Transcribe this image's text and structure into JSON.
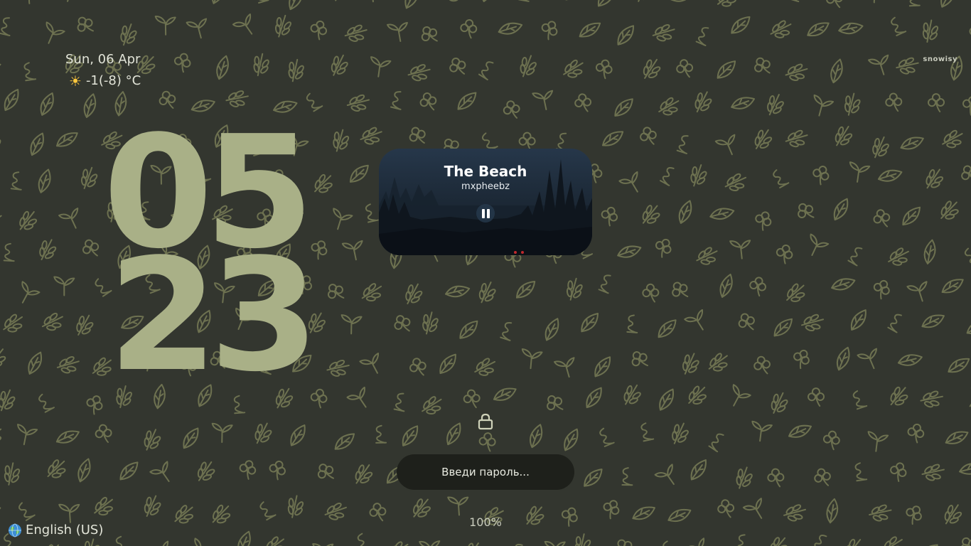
{
  "lockscreen": {
    "date": "Sun, 06 Apr",
    "weather": {
      "icon": "sun-icon",
      "text": "-1(-8) °C"
    },
    "hostname": "snowisy",
    "clock": {
      "hours": "05",
      "minutes": "23"
    },
    "media": {
      "title": "The Beach",
      "artist": "mxpheebz",
      "state_icon": "pause-icon"
    },
    "lock_icon": "lock-icon",
    "password": {
      "placeholder": "Введи пароль...",
      "value": ""
    },
    "battery": "100%",
    "keyboard_layout": {
      "icon": "globe-icon",
      "label": "English (US)"
    }
  },
  "colors": {
    "background": "#33362f",
    "pattern": "#6d7150",
    "clock": "#a9b087",
    "input_bg": "#1e201b",
    "text": "#e2e4d8"
  }
}
